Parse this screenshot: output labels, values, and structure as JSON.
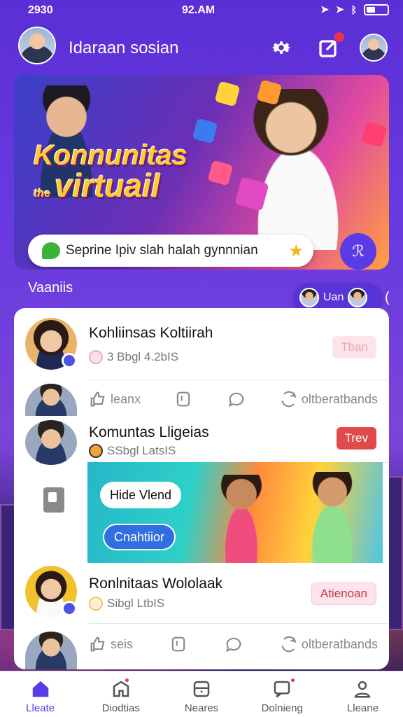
{
  "status_bar": {
    "left_time": "2930",
    "center_time": "92.AM"
  },
  "header": {
    "title": "Idaraan sosian"
  },
  "hero": {
    "headline_line1": "Konnunitas",
    "headline_small": "the",
    "headline_line2": "virtuail",
    "search_text": "Seprine Ipiv slah halah gynnnian"
  },
  "section": {
    "label": "Vaaniis",
    "live_chip_label": "Uan",
    "edge_char": "("
  },
  "posts": [
    {
      "name": "Kohliinsas Koltiirah",
      "meta": "3 Bbgl 4.2bIS",
      "button": "Tban"
    },
    {
      "name": "Komuntas Lligeias",
      "meta": "SSbgl LatsIS",
      "button": "Trev",
      "image_chip1": "Hide Vlend",
      "image_chip2": "Cnahtiior"
    },
    {
      "name": "Ronlnitaas Wololaak",
      "meta": "Sibgl LtbIS",
      "button": "Atienoan"
    }
  ],
  "actions_row1": {
    "like": "leanx",
    "share": "oltberatbands"
  },
  "actions_row2": {
    "like": "seis",
    "share": "oltberatbands"
  },
  "nav": [
    {
      "label": "Lleate",
      "icon": "home-icon"
    },
    {
      "label": "Diodtias",
      "icon": "inbox-icon"
    },
    {
      "label": "Neares",
      "icon": "card-icon"
    },
    {
      "label": "Dolnieng",
      "icon": "message-icon"
    },
    {
      "label": "Lleane",
      "icon": "profile-icon"
    }
  ],
  "colors": {
    "accent": "#5a3be6",
    "background": "#5b2fd6",
    "badge": "#e8344c"
  }
}
